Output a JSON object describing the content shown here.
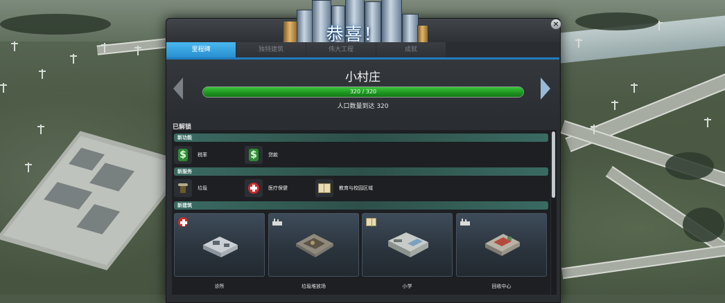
{
  "dialog": {
    "title": "恭喜！",
    "close_symbol": "×",
    "tabs": [
      {
        "label": "里程碑",
        "active": true
      },
      {
        "label": "独特建筑",
        "active": false
      },
      {
        "label": "伟大工程",
        "active": false
      },
      {
        "label": "成就",
        "active": false
      }
    ]
  },
  "milestone": {
    "name": "小村庄",
    "progress_text": "320 / 320",
    "progress_fraction": 1.0,
    "description": "人口数量到达 320"
  },
  "unlocked": {
    "label": "已解锁",
    "sections": {
      "features": {
        "title": "新功能",
        "items": [
          {
            "label": "税率",
            "icon": "dollar-icon"
          },
          {
            "label": "贷款",
            "icon": "dollar-icon"
          }
        ]
      },
      "services": {
        "title": "新服务",
        "items": [
          {
            "label": "垃圾",
            "icon": "trash-icon"
          },
          {
            "label": "医疗保健",
            "icon": "medical-cross-icon"
          },
          {
            "label": "教育与校园区域",
            "icon": "book-icon"
          }
        ]
      },
      "buildings": {
        "title": "新建筑",
        "items": [
          {
            "label": "诊所",
            "icon": "medical-cross-icon"
          },
          {
            "label": "垃圾堆放场",
            "icon": "factory-icon"
          },
          {
            "label": "小学",
            "icon": "book-icon"
          },
          {
            "label": "回收中心",
            "icon": "factory-icon"
          }
        ]
      }
    }
  },
  "colors": {
    "accent_tab": "#2a8fd0",
    "progress_green": "#1d9320",
    "section_bar": "#2d5049"
  }
}
